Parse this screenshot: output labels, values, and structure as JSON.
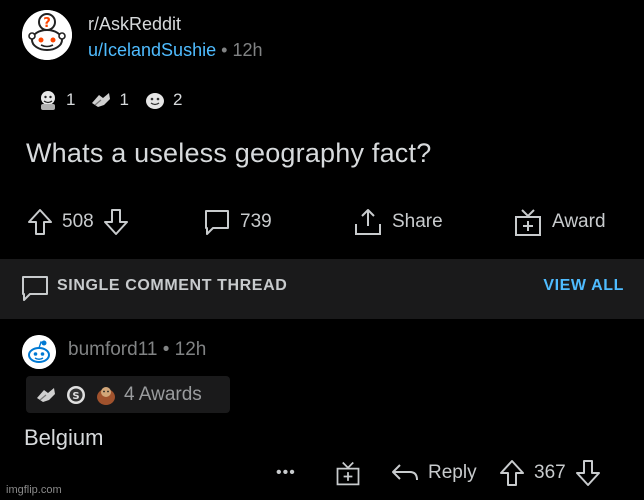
{
  "post": {
    "subreddit": "r/AskReddit",
    "username": "u/IcelandSushie",
    "separator": "•",
    "age": "12h",
    "awards": [
      {
        "icon": "wholesome-award-icon",
        "count": "1"
      },
      {
        "icon": "helpful-award-icon",
        "count": "1"
      },
      {
        "icon": "silver-award-icon",
        "count": "2"
      }
    ],
    "title": "Whats a useless geography fact?",
    "votes": "508",
    "comments": "739",
    "share_label": "Share",
    "award_label": "Award"
  },
  "thread_bar": {
    "label": "SINGLE COMMENT THREAD",
    "view_all": "VIEW ALL"
  },
  "comment": {
    "username": "bumford11",
    "separator": "•",
    "age": "12h",
    "awards_label": "4 Awards",
    "award_icons": [
      "helpful-award-icon",
      "silver-coin-award-icon",
      "take-my-energy-award-icon"
    ],
    "body": "Belgium",
    "more": "•••",
    "reply_label": "Reply",
    "votes": "367"
  },
  "watermark": "imgflip.com",
  "colors": {
    "background": "#000000",
    "bar_background": "#1a1a1b",
    "link_blue": "#4fbcff",
    "text": "#d7dadc",
    "muted": "#818384"
  }
}
